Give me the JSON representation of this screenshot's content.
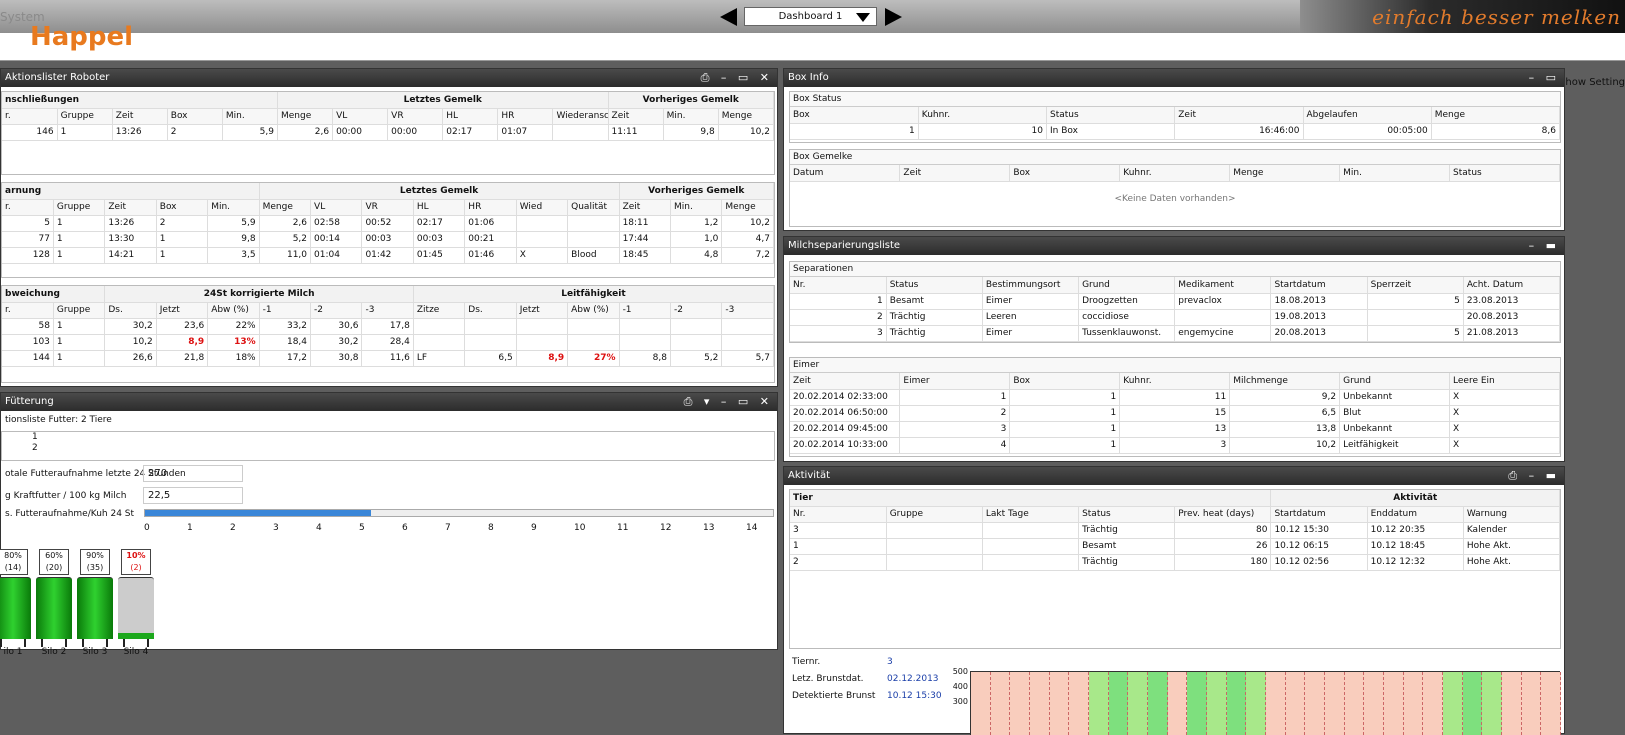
{
  "header": {
    "system": "System",
    "brand": "Happel",
    "dashboard": "Dashboard 1",
    "tagline": "einfach besser melken",
    "show_settings": "Show Setting"
  },
  "robot": {
    "title": "Aktionslister Roboter",
    "anschl": {
      "section": "nschließungen",
      "grp1": "Letztes Gemelk",
      "grp2": "Vorheriges Gemelk",
      "cols": [
        "r.",
        "Gruppe",
        "Zeit",
        "Box",
        "Min.",
        "Menge",
        "VL",
        "VR",
        "HL",
        "HR",
        "Wiederansch",
        "Zeit",
        "Min.",
        "Menge"
      ],
      "rows": [
        [
          "146",
          "1",
          "13:26",
          "2",
          "5,9",
          "2,6",
          "00:00",
          "00:00",
          "02:17",
          "01:07",
          "",
          "11:11",
          "9,8",
          "10,2"
        ]
      ]
    },
    "warnung": {
      "section": "arnung",
      "grp1": "Letztes Gemelk",
      "grp2": "Vorheriges Gemelk",
      "cols": [
        "r.",
        "Gruppe",
        "Zeit",
        "Box",
        "Min.",
        "Menge",
        "VL",
        "VR",
        "HL",
        "HR",
        "Wied",
        "Qualität",
        "Zeit",
        "Min.",
        "Menge"
      ],
      "rows": [
        [
          "5",
          "1",
          "13:26",
          "2",
          "5,9",
          "2,6",
          "02:58",
          "00:52",
          "02:17",
          "01:06",
          "",
          "",
          "18:11",
          "1,2",
          "10,2"
        ],
        [
          "77",
          "1",
          "13:30",
          "1",
          "9,8",
          "5,2",
          "00:14",
          "00:03",
          "00:03",
          "00:21",
          "",
          "",
          "17:44",
          "1,0",
          "4,7"
        ],
        [
          "128",
          "1",
          "14:21",
          "1",
          "3,5",
          "11,0",
          "01:04",
          "01:42",
          "01:45",
          "01:46",
          "X",
          "Blood",
          "18:45",
          "4,8",
          "7,2"
        ]
      ]
    },
    "abw": {
      "section": "bweichung",
      "grp1": "24St korrigierte Milch",
      "grp2": "Leitfähigkeit",
      "cols": [
        "r.",
        "Gruppe",
        "Ds.",
        "Jetzt",
        "Abw (%)",
        "-1",
        "-2",
        "-3",
        "Zitze",
        "Ds.",
        "Jetzt",
        "Abw (%)",
        "-1",
        "-2",
        "-3"
      ],
      "rows": [
        [
          "58",
          "1",
          "30,2",
          "23,6",
          "22%",
          "33,2",
          "30,6",
          "17,8",
          "",
          "",
          "",
          "",
          "",
          "",
          ""
        ],
        [
          "103",
          "1",
          "10,2",
          "8,9",
          "13%",
          "18,4",
          "30,2",
          "28,4",
          "",
          "",
          "",
          "",
          "",
          "",
          ""
        ],
        [
          "144",
          "1",
          "26,6",
          "21,8",
          "18%",
          "17,2",
          "30,8",
          "11,6",
          "LF",
          "6,5",
          "8,9",
          "27%",
          "8,8",
          "5,2",
          "5,7"
        ]
      ]
    }
  },
  "feed": {
    "title": "Fütterung",
    "list_label": "tionsliste Futter: 2 Tiere",
    "animals": [
      "1",
      "2"
    ],
    "total_label": "otale Futteraufnahme letzte 24 Stunden",
    "total_value": "270",
    "kraft_label": "g Kraftfutter / 100 kg Milch",
    "kraft_value": "22,5",
    "avg_label": "s. Futteraufnahme/Kuh 24 St",
    "avg_fraction": 0.36,
    "scale": [
      "0",
      "1",
      "2",
      "3",
      "4",
      "5",
      "6",
      "7",
      "8",
      "9",
      "10",
      "11",
      "12",
      "13",
      "14"
    ],
    "silos": [
      {
        "pct": "80%",
        "n": "(14)",
        "name": "ilo 1",
        "fill": 0.8
      },
      {
        "pct": "60%",
        "n": "(20)",
        "name": "Silo 2",
        "fill": 0.6
      },
      {
        "pct": "90%",
        "n": "(35)",
        "name": "Silo 3",
        "fill": 0.9
      },
      {
        "pct": "10%",
        "n": "(2)",
        "name": "Silo 4",
        "fill": 0.1
      }
    ]
  },
  "box": {
    "title": "Box Info",
    "status_section": "Box Status",
    "status_cols": [
      "Box",
      "Kuhnr.",
      "Status",
      "Zeit",
      "Abgelaufen",
      "Menge"
    ],
    "status_rows": [
      [
        "1",
        "10",
        "In Box",
        "16:46:00",
        "00:05:00",
        "8,6"
      ]
    ],
    "gemelke_section": "Box Gemelke",
    "gemelke_cols": [
      "Datum",
      "Zeit",
      "Box",
      "Kuhnr.",
      "Menge",
      "Min.",
      "Status"
    ],
    "empty": "<Keine Daten vorhanden>"
  },
  "milch": {
    "title": "Milchseparierungsliste",
    "sep_section": "Separationen",
    "sep_cols": [
      "Nr.",
      "Status",
      "Bestimmungsort",
      "Grund",
      "Medikament",
      "Startdatum",
      "Sperrzeit",
      "Acht. Datum"
    ],
    "sep_rows": [
      [
        "1",
        "Besamt",
        "Eimer",
        "Droogzetten",
        "prevaclox",
        "18.08.2013",
        "5",
        "23.08.2013"
      ],
      [
        "2",
        "Trächtig",
        "Leeren",
        "coccidiose",
        "",
        "19.08.2013",
        "",
        "20.08.2013"
      ],
      [
        "3",
        "Trächtig",
        "Eimer",
        "Tussenklauwonst.",
        "engemycine",
        "20.08.2013",
        "5",
        "21.08.2013"
      ]
    ],
    "eimer_section": "Eimer",
    "eimer_cols": [
      "Zeit",
      "Eimer",
      "Box",
      "Kuhnr.",
      "Milchmenge",
      "Grund",
      "Leere Ein"
    ],
    "eimer_rows": [
      [
        "20.02.2014 02:33:00",
        "1",
        "1",
        "11",
        "9,2",
        "Unbekannt"
      ],
      [
        "20.02.2014 06:50:00",
        "2",
        "1",
        "15",
        "6,5",
        "Blut"
      ],
      [
        "20.02.2014 09:45:00",
        "3",
        "1",
        "13",
        "13,8",
        "Unbekannt"
      ],
      [
        "20.02.2014 10:33:00",
        "4",
        "1",
        "3",
        "10,2",
        "Leitfähigkeit"
      ]
    ],
    "x": "X"
  },
  "akt": {
    "title": "Aktivität",
    "grp1": "Tier",
    "grp2": "Aktivität",
    "cols": [
      "Nr.",
      "Gruppe",
      "Lakt Tage",
      "Status",
      "Prev. heat (days)",
      "Startdatum",
      "Enddatum",
      "Warnung"
    ],
    "rows": [
      [
        "3",
        "",
        "",
        "Trächtig",
        "80",
        "10.12 15:30",
        "10.12 20:35",
        "Kalender"
      ],
      [
        "1",
        "",
        "",
        "Besamt",
        "26",
        "10.12 06:15",
        "10.12 18:45",
        "Hohe Akt."
      ],
      [
        "2",
        "",
        "",
        "Trächtig",
        "180",
        "10.12 02:56",
        "10.12 12:32",
        "Hohe Akt."
      ]
    ],
    "info": [
      {
        "k": "Tiernr.",
        "v": "3"
      },
      {
        "k": "Letz. Brunstdat.",
        "v": "02.12.2013"
      },
      {
        "k": "Detektierte Brunst",
        "v": "10.12  15:30"
      }
    ],
    "yticks": [
      "500",
      "400",
      "300"
    ]
  }
}
